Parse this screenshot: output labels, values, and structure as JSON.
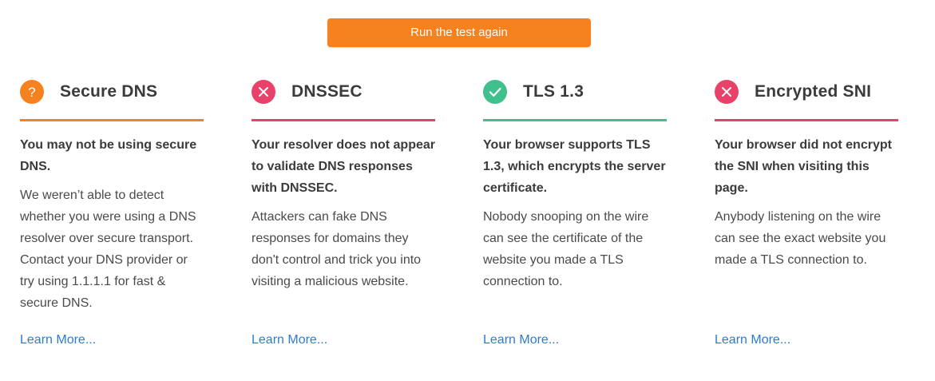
{
  "run_button": {
    "label": "Run the test again"
  },
  "colors": {
    "accent": "#f6821f",
    "fail": "#e9426a",
    "pass": "#40c08d",
    "link": "#2c7cd1"
  },
  "cards": [
    {
      "status": "unknown",
      "icon": "question-icon",
      "title": "Secure DNS",
      "summary": "You may not be using secure DNS.",
      "detail": "We weren’t able to detect whether you were using a DNS resolver over secure transport. Contact your DNS provider or try using 1.1.1.1 for fast & secure DNS.",
      "link": "Learn More..."
    },
    {
      "status": "fail",
      "icon": "close-icon",
      "title": "DNSSEC",
      "summary": "Your resolver does not appear to validate DNS responses with DNSSEC.",
      "detail": "Attackers can fake DNS responses for domains they don't control and trick you into visiting a malicious website.",
      "link": "Learn More..."
    },
    {
      "status": "pass",
      "icon": "check-icon",
      "title": "TLS 1.3",
      "summary": "Your browser supports TLS 1.3, which encrypts the server certificate.",
      "detail": "Nobody snooping on the wire can see the certificate of the website you made a TLS connection to.",
      "link": "Learn More..."
    },
    {
      "status": "fail",
      "icon": "close-icon",
      "title": "Encrypted SNI",
      "summary": "Your browser did not encrypt the SNI when visiting this page.",
      "detail": "Anybody listening on the wire can see the exact website you made a TLS connection to.",
      "link": "Learn More..."
    }
  ]
}
